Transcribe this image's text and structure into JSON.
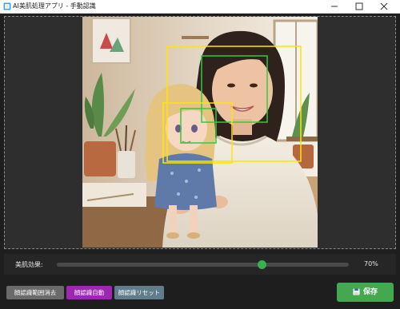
{
  "window": {
    "title": "AI美肌処理アプリ - 手動認識",
    "minimize_glyph": "—",
    "maximize_glyph": "☐",
    "close_glyph": "✕"
  },
  "photo": {
    "face_boxes": [
      {
        "color": "#ffe500",
        "kind": "range"
      },
      {
        "color": "#2ecc40",
        "kind": "face"
      },
      {
        "color": "#ffe500",
        "kind": "range"
      },
      {
        "color": "#2ecc40",
        "kind": "face"
      }
    ]
  },
  "slider": {
    "label": "美肌効果:",
    "value_text": "70%",
    "value": 0.7,
    "accent": "#38b24a"
  },
  "toolbar": {
    "clear_range_label": "顔認識範囲消去",
    "auto_detect_label": "顔認識自動",
    "reset_label": "顔認識リセット",
    "save_label": "保存",
    "save_icon": "floppy-disk-icon"
  },
  "colors": {
    "auto_detect": "#9c27b0",
    "reset": "#607d8b",
    "save": "#43a84f",
    "clear": "#6a6a6a"
  }
}
